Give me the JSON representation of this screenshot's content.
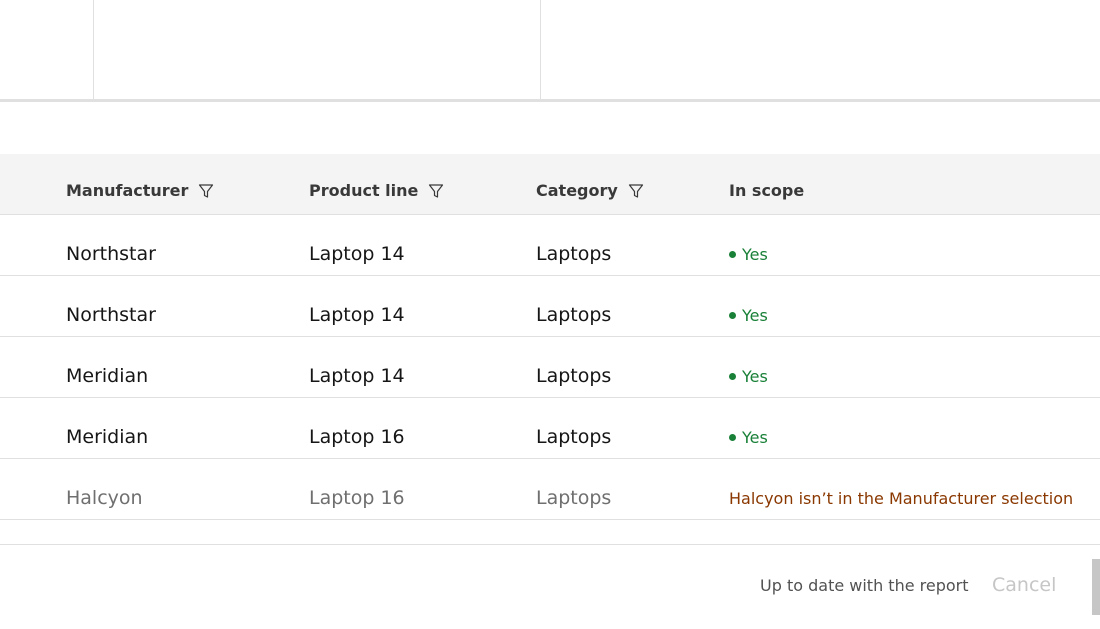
{
  "table": {
    "headers": [
      {
        "label": "Manufacturer",
        "filterable": true,
        "icon": "filter-icon"
      },
      {
        "label": "Product line",
        "filterable": true,
        "icon": "filter-icon"
      },
      {
        "label": "Category",
        "filterable": true,
        "icon": "filter-icon"
      },
      {
        "label": "In scope",
        "filterable": false
      }
    ],
    "rows": [
      {
        "manufacturer": "Northstar",
        "product_line": "Laptop 14",
        "category": "Laptops",
        "in_scope": "Yes"
      },
      {
        "manufacturer": "Northstar",
        "product_line": "Laptop 14",
        "category": "Laptops",
        "in_scope": "Yes"
      },
      {
        "manufacturer": "Meridian",
        "product_line": "Laptop 14",
        "category": "Laptops",
        "in_scope": "Yes"
      },
      {
        "manufacturer": "Meridian",
        "product_line": "Laptop 16",
        "category": "Laptops",
        "in_scope": "Yes"
      },
      {
        "manufacturer": "Halcyon",
        "product_line": "Laptop 16",
        "category": "Laptops",
        "in_scope": "Halcyon isn’t in the Manufacturer selection"
      }
    ]
  },
  "footer": {
    "status": "Up to date with the report",
    "cancel_label": "Cancel"
  },
  "colors": {
    "success": "#198038",
    "warning": "#8a3800",
    "header_bg": "#f4f4f4",
    "border": "#e0e0e0",
    "disabled_text": "#c6c6c6"
  }
}
